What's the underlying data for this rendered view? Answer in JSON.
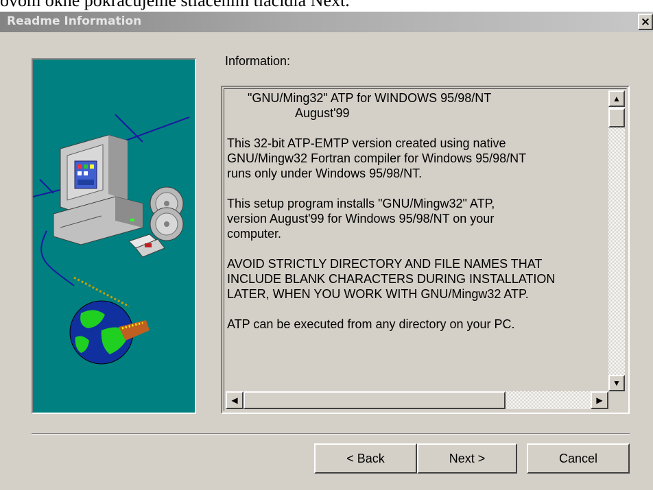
{
  "page_caption": "ovom okne pokračujeme stlačením tlačidla Next.",
  "window": {
    "title": "Readme Information",
    "close_label": "×"
  },
  "info_label": "Information:",
  "readme_lines": [
    "      \"GNU/Ming32\" ATP for WINDOWS 95/98/NT",
    "                    August'99",
    "",
    "This 32-bit ATP-EMTP version created using native",
    "GNU/Mingw32 Fortran compiler for Windows 95/98/NT",
    "runs only under Windows 95/98/NT.",
    "",
    "This setup program installs \"GNU/Mingw32\" ATP,",
    "version August'99 for Windows 95/98/NT on your",
    "computer.",
    "",
    "AVOID STRICTLY DIRECTORY AND FILE NAMES THAT",
    "INCLUDE BLANK CHARACTERS DURING INSTALLATION",
    "LATER, WHEN YOU WORK WITH GNU/Mingw32 ATP.",
    "",
    "ATP can be executed from any directory on your PC."
  ],
  "scrollbars": {
    "up": "▲",
    "down": "▼",
    "left": "◀",
    "right": "▶"
  },
  "buttons": {
    "back": "< Back",
    "next": "Next >",
    "cancel": "Cancel"
  },
  "colors": {
    "dialog_bg": "#d4d0c8",
    "art_bg": "#008080",
    "titlebar_start": "#848484"
  }
}
